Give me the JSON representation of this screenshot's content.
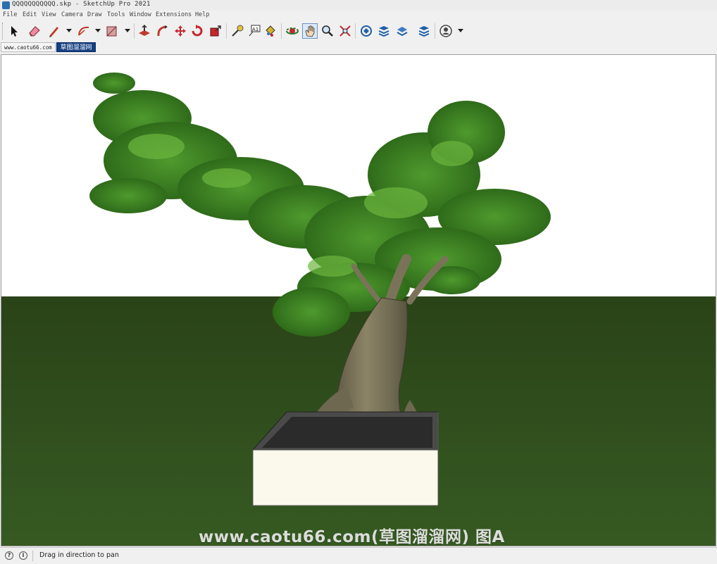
{
  "window": {
    "title": "QQQQQQQQQQQ.skp - SketchUp Pro 2021",
    "icon": "sketchup-logo-icon"
  },
  "menu": {
    "items": [
      "File",
      "Edit",
      "View",
      "Camera",
      "Draw",
      "Tools",
      "Window",
      "Extensions",
      "Help"
    ]
  },
  "toolbar": {
    "tools": [
      "select-icon",
      "eraser-icon",
      "line-pencil-icon",
      "arc-icon",
      "rectangle-icon",
      "push-pull-icon",
      "follow-me-icon",
      "move-icon",
      "rotate-icon",
      "scale-icon",
      "tape-measure-icon",
      "text-icon",
      "paint-bucket-icon",
      "orbit-icon",
      "pan-icon",
      "zoom-icon",
      "zoom-extents-icon",
      "warehouse-icon",
      "extension-warehouse-icon",
      "layers-icon",
      "layout-icon",
      "account-icon"
    ],
    "active_tool": "pan-icon"
  },
  "scene_tabs": [
    {
      "label": "www.caotu66.com",
      "active": false
    },
    {
      "label": "草图溜溜网",
      "active": true
    }
  ],
  "viewport": {
    "sky_color": "#ffffff",
    "ground_color": "#2f4a1c",
    "watermark": "www.caotu66.com(草图溜溜网) 图A"
  },
  "status": {
    "message": "Drag in direction to pan",
    "icons": [
      "geolocation-icon",
      "info-icon"
    ]
  }
}
